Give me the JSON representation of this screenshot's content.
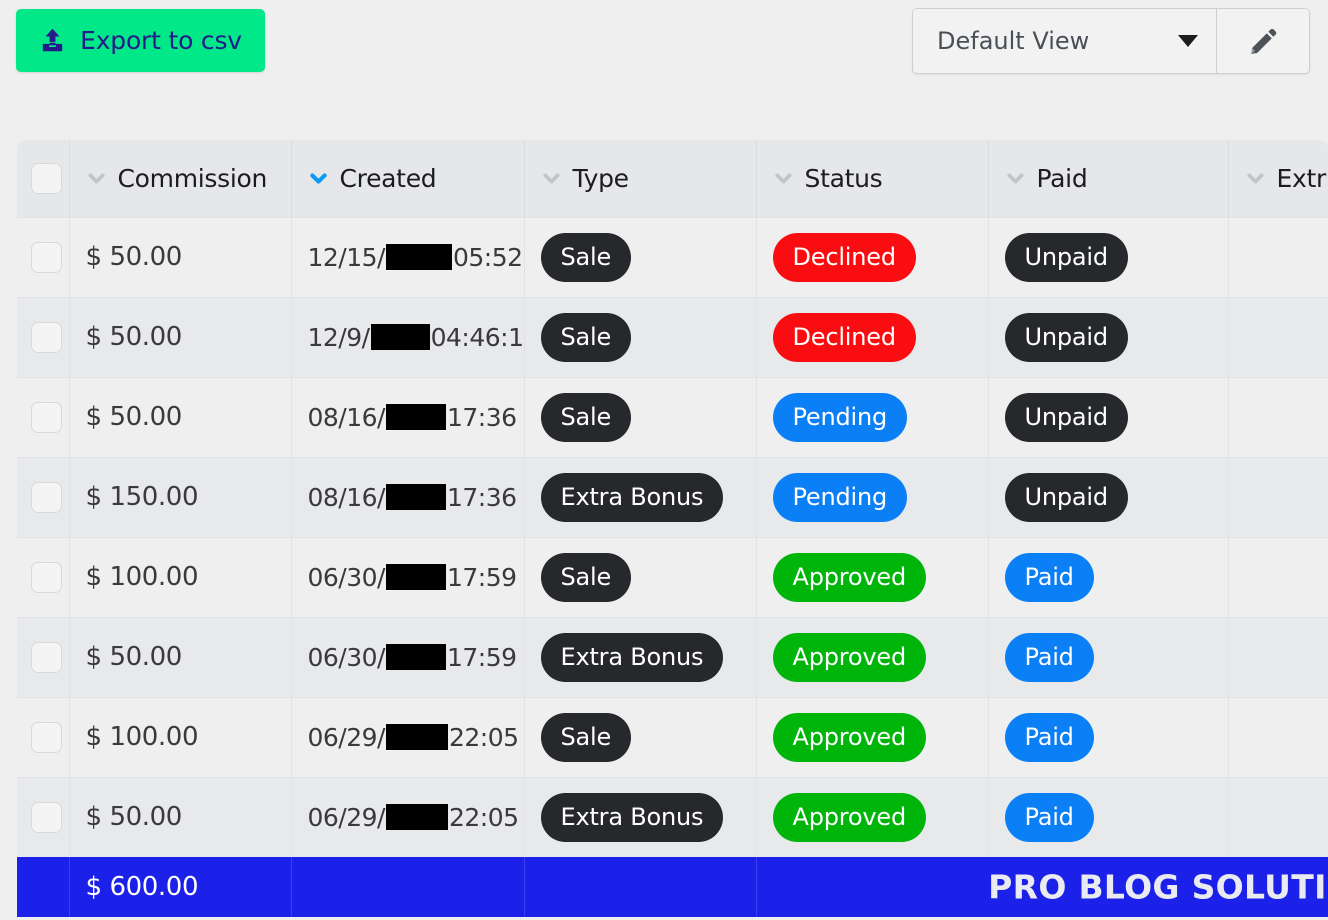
{
  "toolbar": {
    "export_label": "Export to csv",
    "export_icon": "upload-icon",
    "view_value": "Default View",
    "view_caret_icon": "caret-down-icon",
    "edit_icon": "pencil-icon",
    "export_bg": "#00e887",
    "export_fg": "#241a8c"
  },
  "table": {
    "columns": [
      {
        "key": "select",
        "label": "",
        "sorted": false
      },
      {
        "key": "commission",
        "label": "Commission",
        "sorted": false
      },
      {
        "key": "created",
        "label": "Created",
        "sorted": true
      },
      {
        "key": "type",
        "label": "Type",
        "sorted": false
      },
      {
        "key": "status",
        "label": "Status",
        "sorted": false
      },
      {
        "key": "paid",
        "label": "Paid",
        "sorted": false
      },
      {
        "key": "extra",
        "label": "Extr",
        "sorted": false
      }
    ],
    "sort_active_color": "#0b9bf5",
    "sort_inactive_color": "#c3c4c7",
    "rows": [
      {
        "commission": "$ 50.00",
        "date_prefix": "12/15/",
        "redact_w": 66,
        "date_suffix": "05:52",
        "type": "Sale",
        "status": "Declined",
        "status_kind": "declined",
        "paid": "Unpaid",
        "paid_kind": "dark"
      },
      {
        "commission": "$ 50.00",
        "date_prefix": "12/9/",
        "redact_w": 66,
        "date_suffix": "04:46:1",
        "type": "Sale",
        "status": "Declined",
        "status_kind": "declined",
        "paid": "Unpaid",
        "paid_kind": "dark"
      },
      {
        "commission": "$ 50.00",
        "date_prefix": "08/16/",
        "redact_w": 60,
        "date_suffix": " 17:36",
        "type": "Sale",
        "status": "Pending",
        "status_kind": "pending",
        "paid": "Unpaid",
        "paid_kind": "dark"
      },
      {
        "commission": "$ 150.00",
        "date_prefix": "08/16/",
        "redact_w": 60,
        "date_suffix": " 17:36",
        "type": "Extra Bonus",
        "status": "Pending",
        "status_kind": "pending",
        "paid": "Unpaid",
        "paid_kind": "dark"
      },
      {
        "commission": "$ 100.00",
        "date_prefix": "06/30/",
        "redact_w": 60,
        "date_suffix": "17:59",
        "type": "Sale",
        "status": "Approved",
        "status_kind": "approved",
        "paid": "Paid",
        "paid_kind": "paid"
      },
      {
        "commission": "$ 50.00",
        "date_prefix": "06/30/",
        "redact_w": 60,
        "date_suffix": " 17:59",
        "type": "Extra Bonus",
        "status": "Approved",
        "status_kind": "approved",
        "paid": "Paid",
        "paid_kind": "paid"
      },
      {
        "commission": "$ 100.00",
        "date_prefix": "06/29/",
        "redact_w": 62,
        "date_suffix": "22:05",
        "type": "Sale",
        "status": "Approved",
        "status_kind": "approved",
        "paid": "Paid",
        "paid_kind": "paid"
      },
      {
        "commission": "$ 50.00",
        "date_prefix": "06/29/",
        "redact_w": 62,
        "date_suffix": "22:05",
        "type": "Extra Bonus",
        "status": "Approved",
        "status_kind": "approved",
        "paid": "Paid",
        "paid_kind": "paid"
      }
    ],
    "footer": {
      "total": "$ 600.00",
      "watermark": "PRO BLOG SOLUTIONS",
      "bg": "#1b21e8"
    }
  }
}
